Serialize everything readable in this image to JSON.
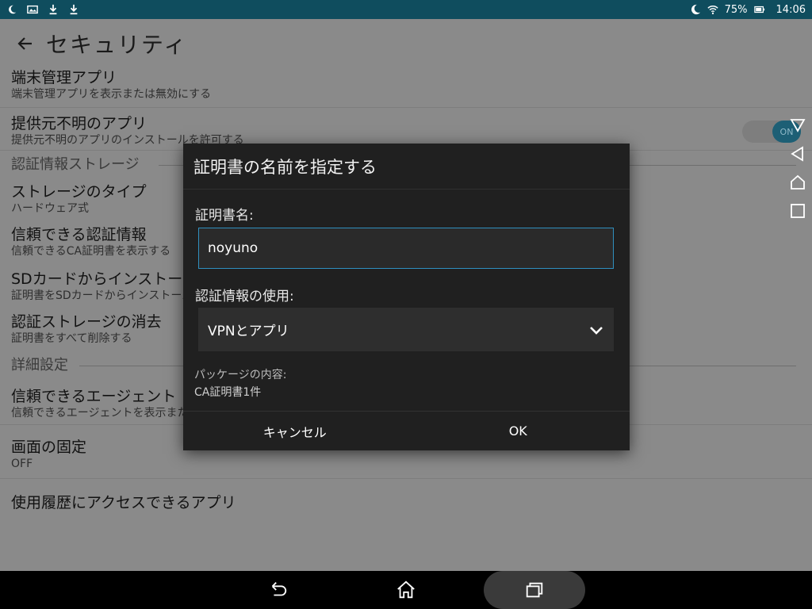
{
  "status_bar": {
    "battery": "75%",
    "time": "14:06"
  },
  "page": {
    "title": "セキュリティ",
    "rows": [
      {
        "title": "端末管理アプリ",
        "subtitle": "端末管理アプリを表示または無効にする"
      },
      {
        "title": "提供元不明のアプリ",
        "subtitle": "提供元不明のアプリのインストールを許可する",
        "toggle": "ON"
      }
    ],
    "section_storage": "認証情報ストレージ",
    "storage_rows": [
      {
        "title": "ストレージのタイプ",
        "subtitle": "ハードウェア式"
      },
      {
        "title": "信頼できる認証情報",
        "subtitle": "信頼できるCA証明書を表示する"
      },
      {
        "title": "SDカードからインストール",
        "subtitle": "証明書をSDカードからインストール"
      },
      {
        "title": "認証ストレージの消去",
        "subtitle": "証明書をすべて削除する"
      }
    ],
    "section_advanced": "詳細設定",
    "advanced_rows": [
      {
        "title": "信頼できるエージェント",
        "subtitle": "信頼できるエージェントを表示または無効にする"
      },
      {
        "title": "画面の固定",
        "subtitle": "OFF"
      },
      {
        "title": "使用履歴にアクセスできるアプリ",
        "subtitle": ""
      }
    ]
  },
  "dialog": {
    "title": "証明書の名前を指定する",
    "name_label": "証明書名:",
    "name_value": "noyuno",
    "usage_label": "認証情報の使用:",
    "usage_value": "VPNとアプリ",
    "package_label": "パッケージの内容:",
    "package_value": "CA証明書1件",
    "cancel": "キャンセル",
    "ok": "OK"
  },
  "colors": {
    "status_bar": "#0f4d5e",
    "accent": "#2f8fbf",
    "dialog_bg": "#202020"
  }
}
